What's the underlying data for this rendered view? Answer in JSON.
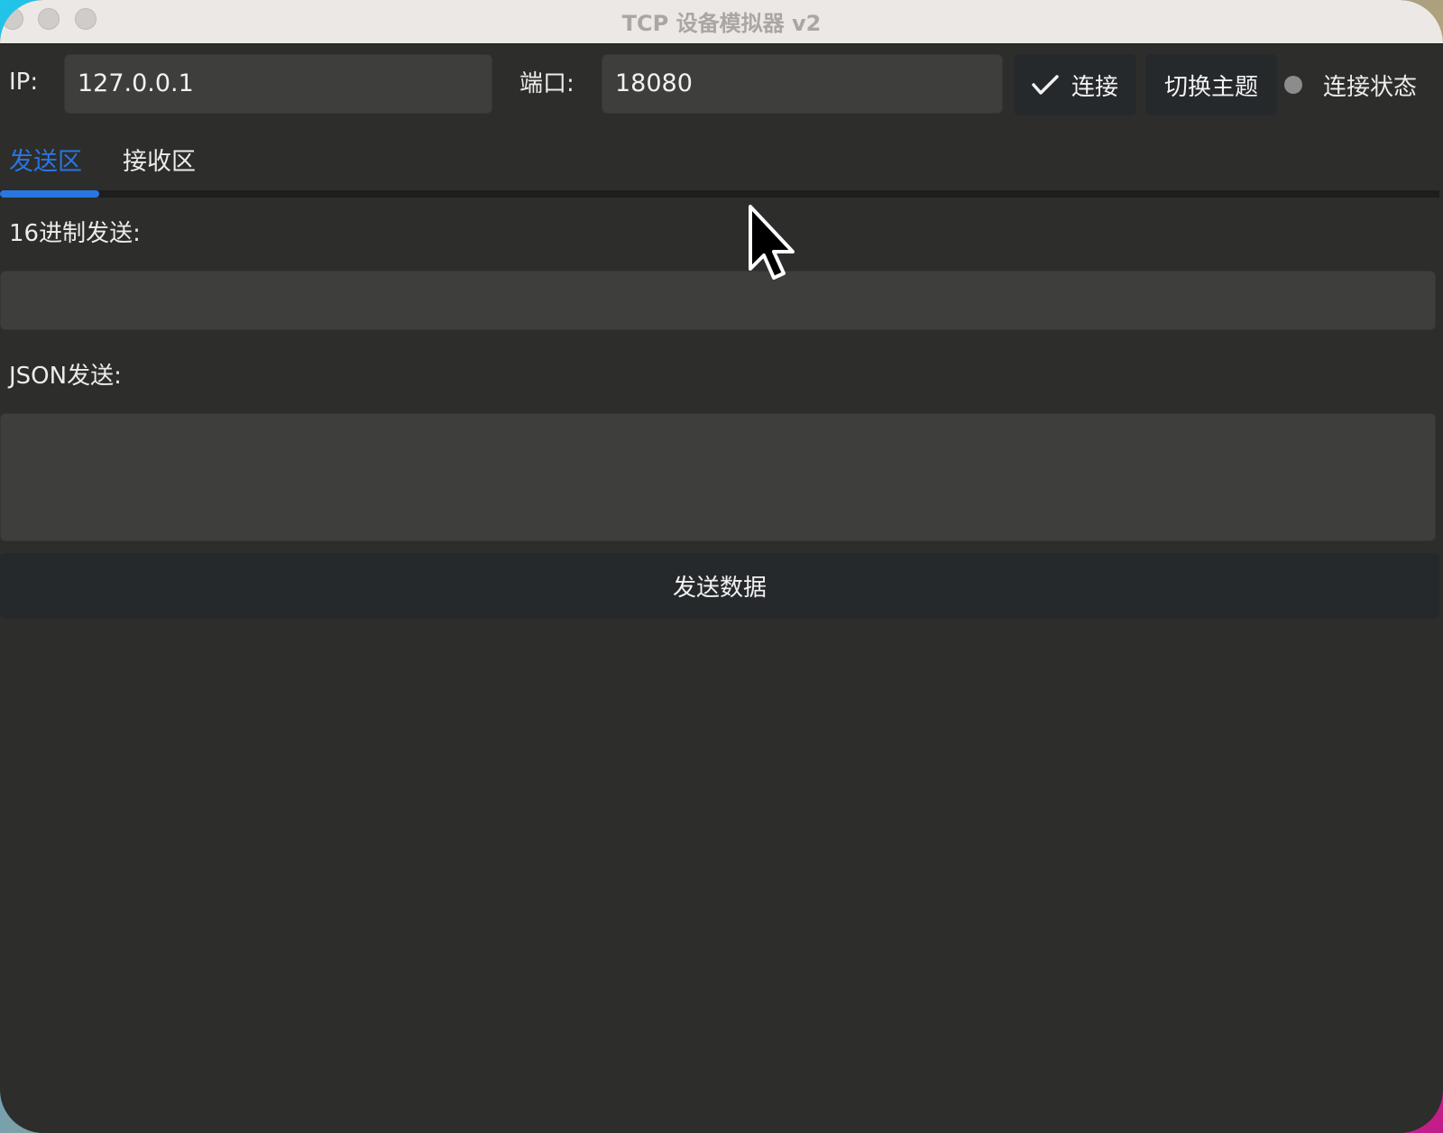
{
  "window": {
    "title": "TCP 设备模拟器 v2"
  },
  "connection": {
    "ip_label": "IP:",
    "ip_value": "127.0.0.1",
    "port_label": "端口:",
    "port_value": "18080",
    "connect_label": "连接",
    "connect_icon": "check-icon",
    "theme_label": "切换主题",
    "status_label": "连接状态",
    "status_color": "#8c8c8c"
  },
  "tabs": {
    "items": [
      {
        "label": "发送区",
        "active": true
      },
      {
        "label": "接收区",
        "active": false
      }
    ],
    "accent": "#2a76e2"
  },
  "send": {
    "hex_label": "16进制发送:",
    "hex_value": "",
    "json_label": "JSON发送:",
    "json_value": "",
    "send_button": "发送数据"
  }
}
